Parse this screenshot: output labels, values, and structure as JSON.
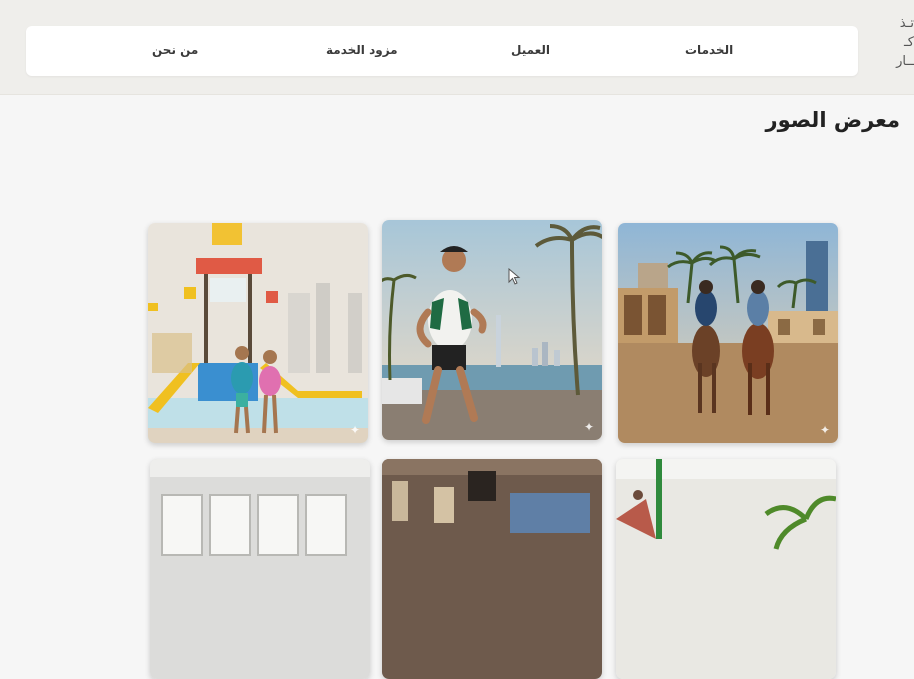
{
  "header": {
    "logo_lines": "تـذ\nكـ\nــار",
    "nav": [
      {
        "label": "الخدمات"
      },
      {
        "label": "العميل"
      },
      {
        "label": "مزود الخدمة"
      },
      {
        "label": "من نحن"
      }
    ]
  },
  "gallery": {
    "title": "معرض الصور",
    "photos": [
      {
        "subject": "riders-on-horses"
      },
      {
        "subject": "runner-on-waterfront"
      },
      {
        "subject": "kids-at-waterpark"
      },
      {
        "subject": "atrium-greenery"
      },
      {
        "subject": "restaurant-interior"
      },
      {
        "subject": "bright-hall-windows"
      }
    ]
  },
  "colors": {
    "header_bg": "#efeeeb",
    "nav_bg": "#ffffff",
    "page_bg": "#f6f6f6"
  }
}
